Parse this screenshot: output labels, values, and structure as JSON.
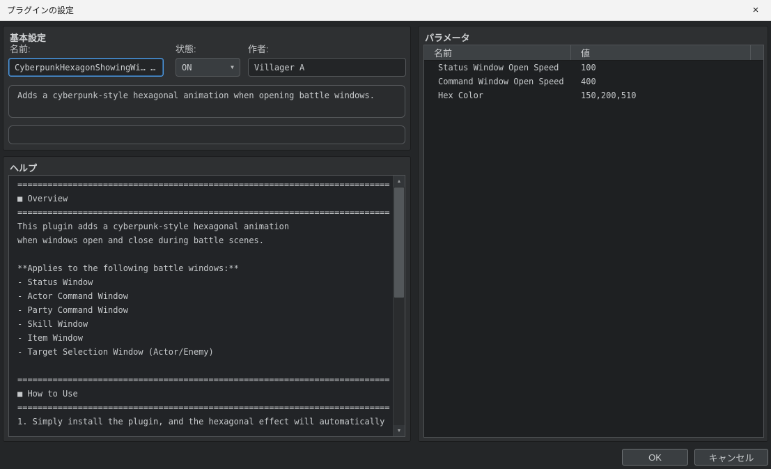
{
  "window": {
    "title": "プラグインの設定"
  },
  "icons": {
    "close": "×",
    "chevron_down": "▼",
    "scroll_up": "▲",
    "scroll_down": "▼"
  },
  "basic": {
    "title": "基本設定",
    "name_label": "名前:",
    "name_value": "CyberpunkHexagonShowingWi… …",
    "status_label": "状態:",
    "status_value": "ON",
    "author_label": "作者:",
    "author_value": "Villager A",
    "description": "Adds a cyberpunk-style hexagonal animation when opening battle windows.",
    "extra_value": ""
  },
  "help": {
    "title": "ヘルプ",
    "lines": [
      "==========================================================================",
      "■ Overview",
      "==========================================================================",
      "This plugin adds a cyberpunk-style hexagonal animation",
      "when windows open and close during battle scenes.",
      "",
      "**Applies to the following battle windows:**",
      "- Status Window",
      "- Actor Command Window",
      "- Party Command Window",
      "- Skill Window",
      "- Item Window",
      "- Target Selection Window (Actor/Enemy)",
      "",
      "==========================================================================",
      "■ How to Use",
      "==========================================================================",
      "1. Simply install the plugin, and the hexagonal effect will automatically"
    ]
  },
  "parameters": {
    "title": "パラメータ",
    "columns": {
      "name": "名前",
      "value": "値"
    },
    "rows": [
      {
        "name": "Status Window Open Speed",
        "value": "100"
      },
      {
        "name": "Command Window Open Speed",
        "value": "400"
      },
      {
        "name": "Hex Color",
        "value": "150,200,510"
      }
    ]
  },
  "footer": {
    "ok_label": "OK",
    "cancel_label": "キャンセル"
  },
  "colors": {
    "accent_focus": "#4e9ae2",
    "window_bg": "#242628",
    "titlebar_bg": "#f3f3f3"
  }
}
